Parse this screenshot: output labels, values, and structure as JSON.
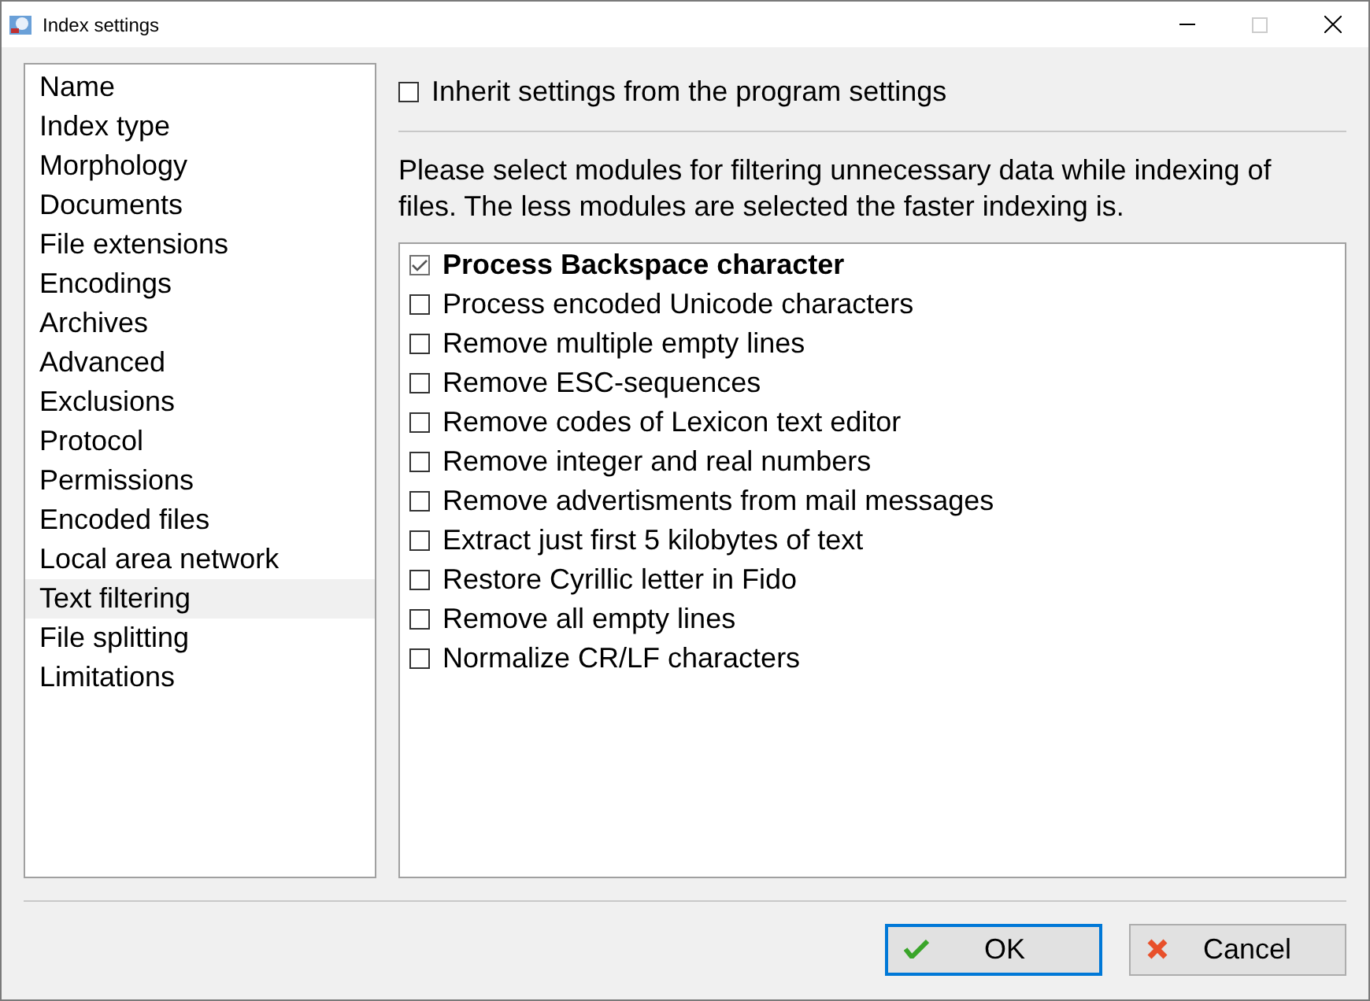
{
  "window": {
    "title": "Index settings"
  },
  "sidebar": {
    "items": [
      {
        "label": "Name",
        "selected": false
      },
      {
        "label": "Index type",
        "selected": false
      },
      {
        "label": "Morphology",
        "selected": false
      },
      {
        "label": "Documents",
        "selected": false
      },
      {
        "label": "File extensions",
        "selected": false
      },
      {
        "label": "Encodings",
        "selected": false
      },
      {
        "label": "Archives",
        "selected": false
      },
      {
        "label": "Advanced",
        "selected": false
      },
      {
        "label": "Exclusions",
        "selected": false
      },
      {
        "label": "Protocol",
        "selected": false
      },
      {
        "label": "Permissions",
        "selected": false
      },
      {
        "label": "Encoded files",
        "selected": false
      },
      {
        "label": "Local area network",
        "selected": false
      },
      {
        "label": "Text filtering",
        "selected": true
      },
      {
        "label": "File splitting",
        "selected": false
      },
      {
        "label": "Limitations",
        "selected": false
      }
    ]
  },
  "inherit": {
    "label": "Inherit settings from the program settings",
    "checked": false
  },
  "description": "Please select modules for filtering unnecessary data while indexing of files. The less modules are selected the faster indexing is.",
  "modules": [
    {
      "label": "Process Backspace character",
      "checked": true
    },
    {
      "label": "Process encoded Unicode characters",
      "checked": false
    },
    {
      "label": "Remove multiple empty lines",
      "checked": false
    },
    {
      "label": "Remove ESC-sequences",
      "checked": false
    },
    {
      "label": "Remove codes of Lexicon text editor",
      "checked": false
    },
    {
      "label": "Remove integer and real numbers",
      "checked": false
    },
    {
      "label": "Remove advertisments from mail messages",
      "checked": false
    },
    {
      "label": "Extract just first 5 kilobytes of text",
      "checked": false
    },
    {
      "label": "Restore Cyrillic letter in Fido",
      "checked": false
    },
    {
      "label": "Remove all empty lines",
      "checked": false
    },
    {
      "label": "Normalize CR/LF characters",
      "checked": false
    }
  ],
  "buttons": [
    {
      "label": "OK",
      "kind": "ok"
    },
    {
      "label": "Cancel",
      "kind": "cancel"
    }
  ]
}
